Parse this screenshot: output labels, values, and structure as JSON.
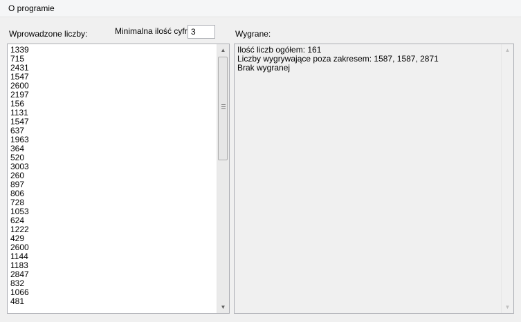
{
  "menu": {
    "items": [
      "O programie"
    ]
  },
  "labels": {
    "entered_numbers": "Wprowadzone liczby:",
    "min_digits": "Minimalna ilość cyfr::",
    "wins": "Wygrane:"
  },
  "min_digits_value": "3",
  "numbers": [
    "1339",
    "715",
    "2431",
    "1547",
    "2600",
    "2197",
    "156",
    "1131",
    "1547",
    "637",
    "1963",
    "364",
    "520",
    "3003",
    "260",
    "897",
    "806",
    "728",
    "1053",
    "624",
    "1222",
    "429",
    "2600",
    "1144",
    "1183",
    "2847",
    "832",
    "1066",
    "481"
  ],
  "results": [
    "Ilość liczb ogółem: 161",
    "Liczby wygrywające poza zakresem: 1587, 1587, 2871",
    "Brak wygranej"
  ],
  "icons": {
    "scroll_up": "scroll-up-arrow-icon",
    "scroll_down": "scroll-down-arrow-icon"
  }
}
